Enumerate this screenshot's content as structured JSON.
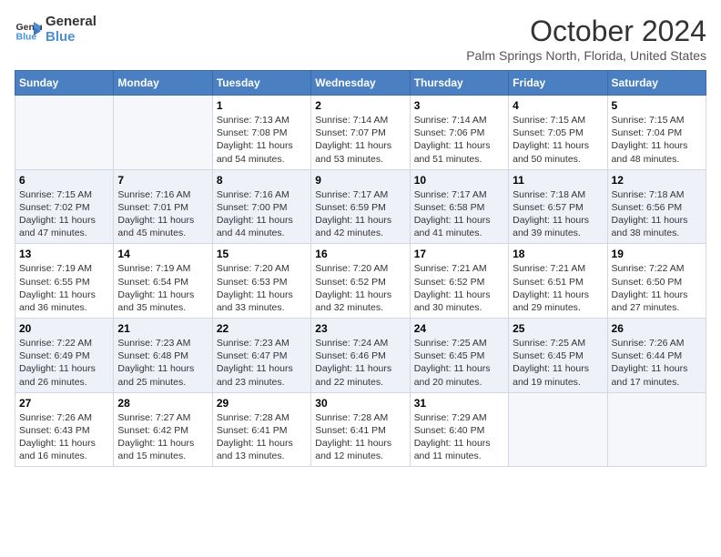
{
  "logo": {
    "line1": "General",
    "line2": "Blue"
  },
  "title": "October 2024",
  "location": "Palm Springs North, Florida, United States",
  "days_of_week": [
    "Sunday",
    "Monday",
    "Tuesday",
    "Wednesday",
    "Thursday",
    "Friday",
    "Saturday"
  ],
  "weeks": [
    [
      {
        "day": "",
        "info": ""
      },
      {
        "day": "",
        "info": ""
      },
      {
        "day": "1",
        "info": "Sunrise: 7:13 AM\nSunset: 7:08 PM\nDaylight: 11 hours and 54 minutes."
      },
      {
        "day": "2",
        "info": "Sunrise: 7:14 AM\nSunset: 7:07 PM\nDaylight: 11 hours and 53 minutes."
      },
      {
        "day": "3",
        "info": "Sunrise: 7:14 AM\nSunset: 7:06 PM\nDaylight: 11 hours and 51 minutes."
      },
      {
        "day": "4",
        "info": "Sunrise: 7:15 AM\nSunset: 7:05 PM\nDaylight: 11 hours and 50 minutes."
      },
      {
        "day": "5",
        "info": "Sunrise: 7:15 AM\nSunset: 7:04 PM\nDaylight: 11 hours and 48 minutes."
      }
    ],
    [
      {
        "day": "6",
        "info": "Sunrise: 7:15 AM\nSunset: 7:02 PM\nDaylight: 11 hours and 47 minutes."
      },
      {
        "day": "7",
        "info": "Sunrise: 7:16 AM\nSunset: 7:01 PM\nDaylight: 11 hours and 45 minutes."
      },
      {
        "day": "8",
        "info": "Sunrise: 7:16 AM\nSunset: 7:00 PM\nDaylight: 11 hours and 44 minutes."
      },
      {
        "day": "9",
        "info": "Sunrise: 7:17 AM\nSunset: 6:59 PM\nDaylight: 11 hours and 42 minutes."
      },
      {
        "day": "10",
        "info": "Sunrise: 7:17 AM\nSunset: 6:58 PM\nDaylight: 11 hours and 41 minutes."
      },
      {
        "day": "11",
        "info": "Sunrise: 7:18 AM\nSunset: 6:57 PM\nDaylight: 11 hours and 39 minutes."
      },
      {
        "day": "12",
        "info": "Sunrise: 7:18 AM\nSunset: 6:56 PM\nDaylight: 11 hours and 38 minutes."
      }
    ],
    [
      {
        "day": "13",
        "info": "Sunrise: 7:19 AM\nSunset: 6:55 PM\nDaylight: 11 hours and 36 minutes."
      },
      {
        "day": "14",
        "info": "Sunrise: 7:19 AM\nSunset: 6:54 PM\nDaylight: 11 hours and 35 minutes."
      },
      {
        "day": "15",
        "info": "Sunrise: 7:20 AM\nSunset: 6:53 PM\nDaylight: 11 hours and 33 minutes."
      },
      {
        "day": "16",
        "info": "Sunrise: 7:20 AM\nSunset: 6:52 PM\nDaylight: 11 hours and 32 minutes."
      },
      {
        "day": "17",
        "info": "Sunrise: 7:21 AM\nSunset: 6:52 PM\nDaylight: 11 hours and 30 minutes."
      },
      {
        "day": "18",
        "info": "Sunrise: 7:21 AM\nSunset: 6:51 PM\nDaylight: 11 hours and 29 minutes."
      },
      {
        "day": "19",
        "info": "Sunrise: 7:22 AM\nSunset: 6:50 PM\nDaylight: 11 hours and 27 minutes."
      }
    ],
    [
      {
        "day": "20",
        "info": "Sunrise: 7:22 AM\nSunset: 6:49 PM\nDaylight: 11 hours and 26 minutes."
      },
      {
        "day": "21",
        "info": "Sunrise: 7:23 AM\nSunset: 6:48 PM\nDaylight: 11 hours and 25 minutes."
      },
      {
        "day": "22",
        "info": "Sunrise: 7:23 AM\nSunset: 6:47 PM\nDaylight: 11 hours and 23 minutes."
      },
      {
        "day": "23",
        "info": "Sunrise: 7:24 AM\nSunset: 6:46 PM\nDaylight: 11 hours and 22 minutes."
      },
      {
        "day": "24",
        "info": "Sunrise: 7:25 AM\nSunset: 6:45 PM\nDaylight: 11 hours and 20 minutes."
      },
      {
        "day": "25",
        "info": "Sunrise: 7:25 AM\nSunset: 6:45 PM\nDaylight: 11 hours and 19 minutes."
      },
      {
        "day": "26",
        "info": "Sunrise: 7:26 AM\nSunset: 6:44 PM\nDaylight: 11 hours and 17 minutes."
      }
    ],
    [
      {
        "day": "27",
        "info": "Sunrise: 7:26 AM\nSunset: 6:43 PM\nDaylight: 11 hours and 16 minutes."
      },
      {
        "day": "28",
        "info": "Sunrise: 7:27 AM\nSunset: 6:42 PM\nDaylight: 11 hours and 15 minutes."
      },
      {
        "day": "29",
        "info": "Sunrise: 7:28 AM\nSunset: 6:41 PM\nDaylight: 11 hours and 13 minutes."
      },
      {
        "day": "30",
        "info": "Sunrise: 7:28 AM\nSunset: 6:41 PM\nDaylight: 11 hours and 12 minutes."
      },
      {
        "day": "31",
        "info": "Sunrise: 7:29 AM\nSunset: 6:40 PM\nDaylight: 11 hours and 11 minutes."
      },
      {
        "day": "",
        "info": ""
      },
      {
        "day": "",
        "info": ""
      }
    ]
  ]
}
